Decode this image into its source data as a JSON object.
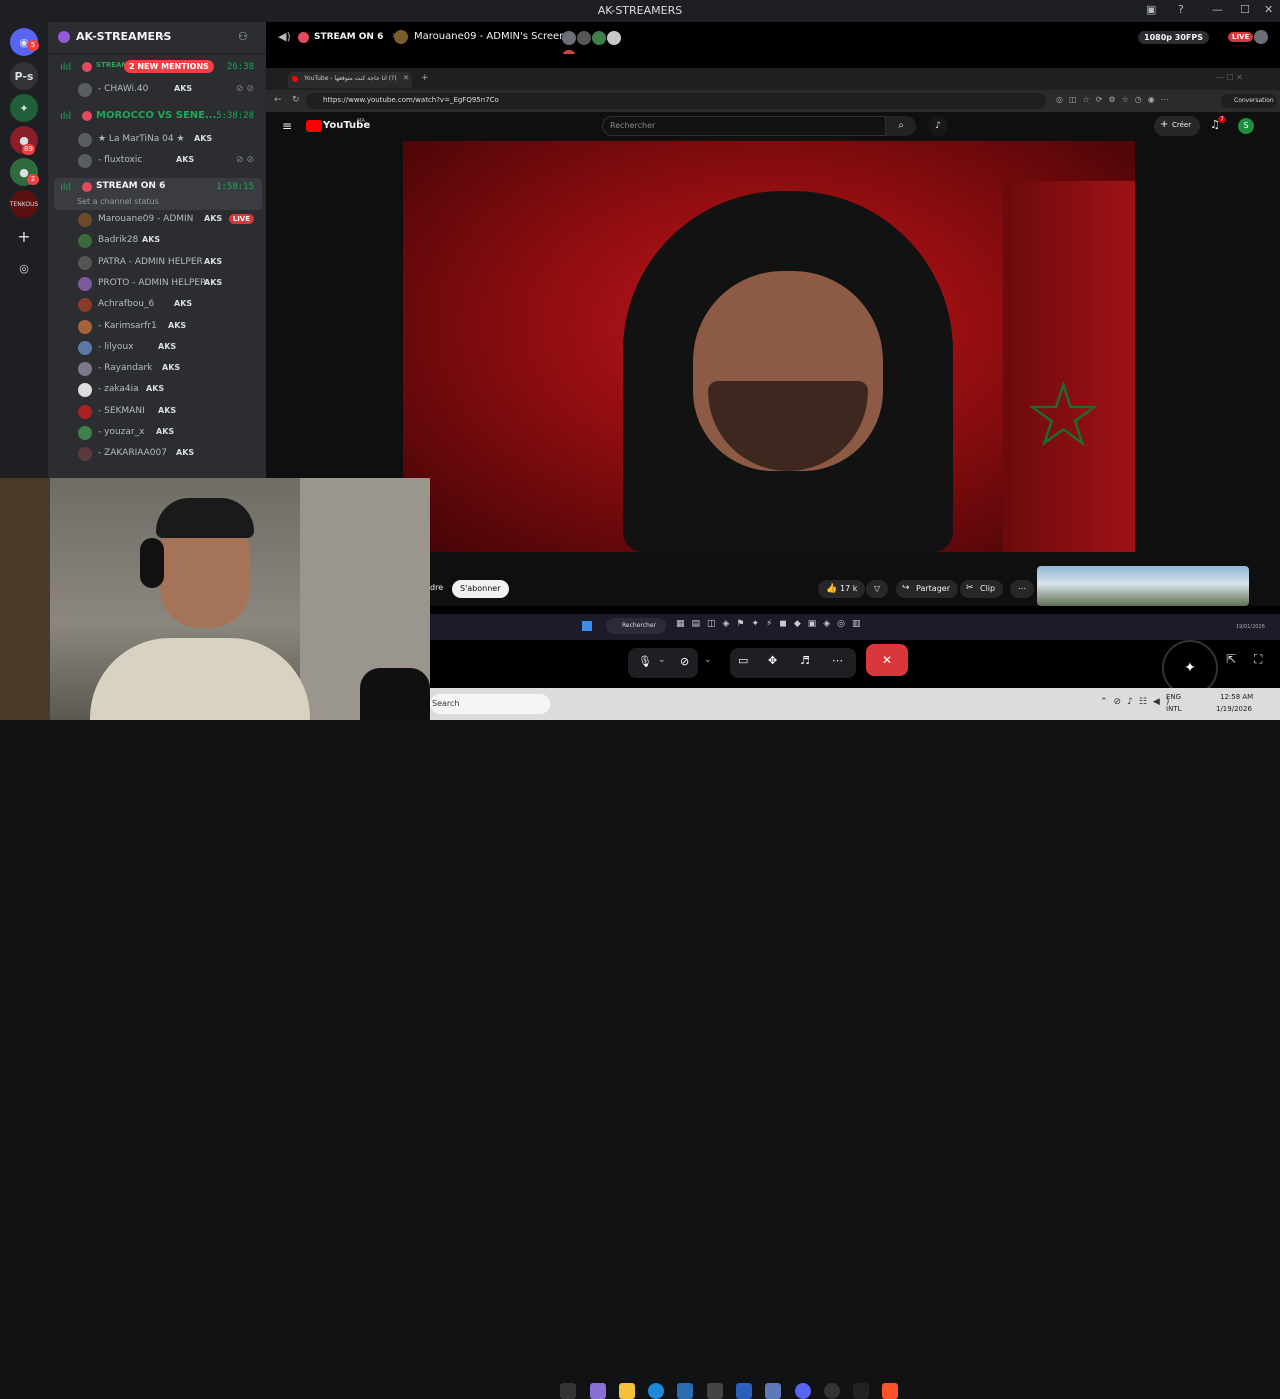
{
  "app": {
    "title": "AK-STREAMERS"
  },
  "rail": {
    "badges": {
      "dm": "5",
      "srv1": "89",
      "srv2": "2"
    },
    "items": [
      "P-s",
      "TENKOUS"
    ]
  },
  "server": {
    "name": "AK-STREAMERS",
    "mentions": "2 NEW MENTIONS"
  },
  "channels": [
    {
      "name": "STREAM",
      "time": "26:38",
      "users": [
        {
          "name": "- CHAWi.40",
          "tag": "AKS"
        }
      ]
    },
    {
      "name": "MOROCCO VS SENE...",
      "time": "5:38:28",
      "users": [
        {
          "name": "★ La MarTiNa 04 ★",
          "tag": "AKS"
        },
        {
          "name": "- fluxtoxic",
          "tag": "AKS"
        }
      ]
    },
    {
      "name": "STREAM ON 6",
      "time": "1:58:15",
      "status": "Set a channel status",
      "users": [
        {
          "name": "Marouane09 - ADMIN",
          "tag": "AKS",
          "live": "LIVE"
        },
        {
          "name": "Badrik28",
          "tag": "AKS"
        },
        {
          "name": "PATRA - ADMIN HELPER",
          "tag": "AKS"
        },
        {
          "name": "PROTO - ADMIN HELPER",
          "tag": "AKS"
        },
        {
          "name": "Achrafbou_6",
          "tag": "AKS"
        },
        {
          "name": "- Karimsarfr1",
          "tag": "AKS"
        },
        {
          "name": "- lilyoux",
          "tag": "AKS"
        },
        {
          "name": "- Rayandark",
          "tag": "AKS"
        },
        {
          "name": "- zaka4ia",
          "tag": "AKS"
        },
        {
          "name": "- SEKMANI",
          "tag": "AKS"
        },
        {
          "name": "- youzar_x",
          "tag": "AKS"
        },
        {
          "name": "- ZAKARIAA007",
          "tag": "AKS"
        }
      ]
    }
  ],
  "stream": {
    "channel": "STREAM ON 6",
    "streamer": "Marouane09 - ADMIN's Screen",
    "quality": "1080p 30FPS",
    "live": "LIVE"
  },
  "browser": {
    "tab": "YouTube - أنا حاجة كنت متوقعها (?)",
    "url": "https://www.youtube.com/watch?v=_EgFQ95n7Co",
    "conversation": "Conversation"
  },
  "youtube": {
    "logo": "YouTube",
    "region": "MA",
    "search_placeholder": "Rechercher",
    "create": "Créer",
    "notif_count": "7",
    "avatar": "S",
    "subscribe": "S'abonner",
    "prefix": "dre",
    "likes": "17 k",
    "share": "Partager",
    "clip": "Clip"
  },
  "inner_taskbar": {
    "search": "Rechercher",
    "date": "19/01/2026"
  },
  "taskbar": {
    "search": "Search",
    "lang1": "ENG",
    "lang2": "INTL",
    "time": "12:58 AM",
    "date": "1/19/2026"
  },
  "colors": {
    "accent": "#23a55a",
    "live": "#da373c",
    "mention": "#f23f43"
  }
}
